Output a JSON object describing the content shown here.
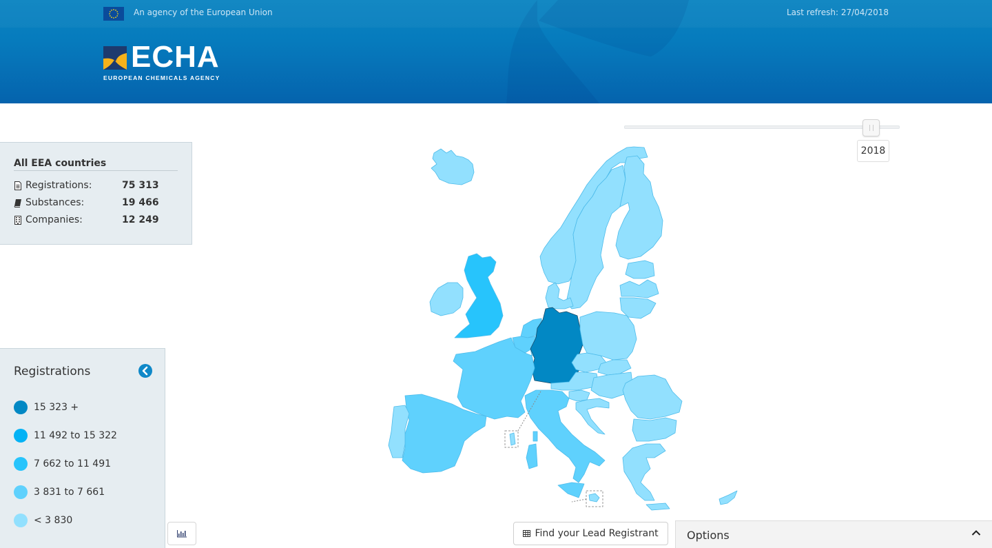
{
  "header": {
    "agency_text": "An agency of the European Union",
    "last_refresh": "Last refresh: 27/04/2018",
    "logo_word": "ECHA",
    "logo_subtitle": "EUROPEAN CHEMICALS AGENCY",
    "colors": {
      "band_top": "#0a84c1",
      "band_bottom": "#0563ad",
      "logo_yellow": "#f6b21b",
      "logo_navy": "#1d3a6e"
    }
  },
  "stats": {
    "title": "All EEA countries",
    "rows": [
      {
        "icon": "document-icon",
        "label": "Registrations:",
        "value": "75 313"
      },
      {
        "icon": "book-icon",
        "label": "Substances:",
        "value": "19 466"
      },
      {
        "icon": "building-icon",
        "label": "Companies:",
        "value": "12 249"
      }
    ]
  },
  "legend": {
    "title": "Registrations",
    "collapse_icon": "chevron-left-circle-icon",
    "items": [
      {
        "label": "15 323 +",
        "color": "#0288c4"
      },
      {
        "label": "11 492 to 15 322",
        "color": "#03b2f5"
      },
      {
        "label": "7 662 to 11 491",
        "color": "#27c4fc"
      },
      {
        "label": "3 831 to 7 661",
        "color": "#5fd1fd"
      },
      {
        "label": "< 3 830",
        "color": "#92e0fe"
      }
    ]
  },
  "slider": {
    "year": "2018",
    "position": 0.9
  },
  "buttons": {
    "chart_icon": "bar-chart-icon",
    "lead_registrant": "Find your Lead Registrant",
    "lead_icon": "table-icon",
    "options": "Options",
    "options_icon": "chevron-up-icon"
  },
  "map": {
    "countries": [
      {
        "name": "Iceland",
        "band": 4
      },
      {
        "name": "Norway",
        "band": 4
      },
      {
        "name": "Sweden",
        "band": 4
      },
      {
        "name": "Finland",
        "band": 4
      },
      {
        "name": "Estonia",
        "band": 4
      },
      {
        "name": "Latvia",
        "band": 4
      },
      {
        "name": "Lithuania",
        "band": 4
      },
      {
        "name": "Denmark",
        "band": 4
      },
      {
        "name": "Ireland",
        "band": 4
      },
      {
        "name": "United Kingdom",
        "band": 2
      },
      {
        "name": "Netherlands",
        "band": 3
      },
      {
        "name": "Belgium",
        "band": 3
      },
      {
        "name": "Luxembourg",
        "band": 4
      },
      {
        "name": "Germany",
        "band": 0
      },
      {
        "name": "Poland",
        "band": 4
      },
      {
        "name": "Czech Republic",
        "band": 4
      },
      {
        "name": "Slovakia",
        "band": 4
      },
      {
        "name": "Austria",
        "band": 4
      },
      {
        "name": "Liechtenstein",
        "band": 4
      },
      {
        "name": "Hungary",
        "band": 4
      },
      {
        "name": "Slovenia",
        "band": 4
      },
      {
        "name": "Croatia",
        "band": 4
      },
      {
        "name": "Romania",
        "band": 4
      },
      {
        "name": "Bulgaria",
        "band": 4
      },
      {
        "name": "Greece",
        "band": 4
      },
      {
        "name": "Cyprus",
        "band": 4
      },
      {
        "name": "France",
        "band": 3
      },
      {
        "name": "Spain",
        "band": 3
      },
      {
        "name": "Portugal",
        "band": 4
      },
      {
        "name": "Italy",
        "band": 3
      },
      {
        "name": "Malta",
        "band": 4
      }
    ]
  }
}
